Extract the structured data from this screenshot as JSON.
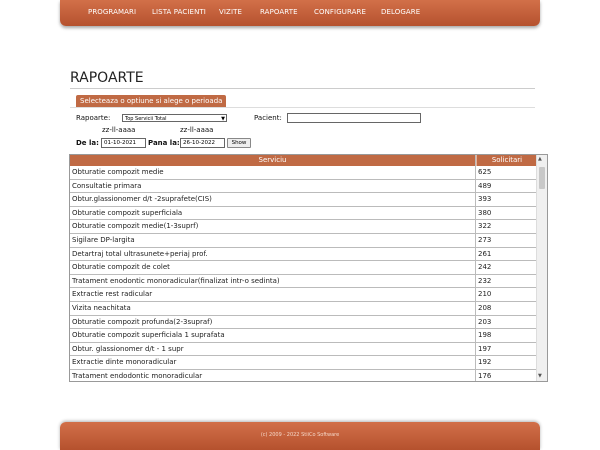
{
  "nav": [
    "PROGRAMARI",
    "LISTA PACIENTI",
    "VIZITE",
    "RAPOARTE",
    "CONFIGURARE",
    "DELOGARE"
  ],
  "page_title": "RAPOARTE",
  "panel_header": "Selecteaza o optiune si alege o perioada",
  "form": {
    "rapoarte_label": "Rapoarte:",
    "rapoarte_value": "Top Servicii Total",
    "pacient_label": "Pacient:",
    "pacient_value": "",
    "date_hint_1": "zz-ll-aaaa",
    "date_hint_2": "zz-ll-aaaa",
    "de_la_label": "De la:",
    "de_la_value": "01-10-2021",
    "pana_la_label": "Pana la:",
    "pana_la_value": "26-10-2022",
    "show_button": "Show"
  },
  "table": {
    "headers": [
      "Serviciu",
      "Solicitari"
    ],
    "rows": [
      [
        "Obturatie compozit medie",
        "625"
      ],
      [
        "Consultatie primara",
        "489"
      ],
      [
        "Obtur.glassionomer d/t -2suprafete(CIS)",
        "393"
      ],
      [
        "Obturatie compozit superficiala",
        "380"
      ],
      [
        "Obturatie compozit medie(1-3suprf)",
        "322"
      ],
      [
        "Sigilare DP-largita",
        "273"
      ],
      [
        "Detartraj total ultrasunete+periaj prof.",
        "261"
      ],
      [
        "Obturatie compozit de colet",
        "242"
      ],
      [
        "Tratament enodontic monoradicular(finalizat intr-o sedinta)",
        "232"
      ],
      [
        "Extractie rest radicular",
        "210"
      ],
      [
        "Vizita neachitata",
        "208"
      ],
      [
        "Obturatie compozit profunda(2-3supraf)",
        "203"
      ],
      [
        "Obturatie compozit superficiala 1 suprafata",
        "198"
      ],
      [
        "Obtur. glassionomer d/t - 1 supr",
        "197"
      ],
      [
        "Extractie dinte monoradicular",
        "192"
      ],
      [
        "Tratament endodontic monoradicular",
        "176"
      ]
    ]
  },
  "footer": "(c) 2009 - 2022 StiiCo Software",
  "colors": {
    "accent": "#c06a44",
    "bar": "#b5512e"
  }
}
